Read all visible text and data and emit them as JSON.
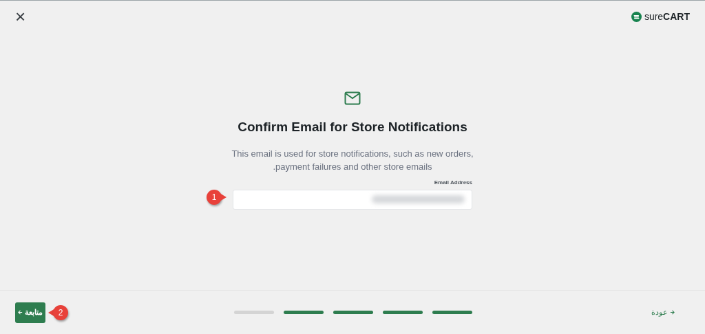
{
  "header": {
    "close_label": "×",
    "logo": {
      "light": "sure",
      "bold": "CART"
    }
  },
  "main": {
    "title": "Confirm Email for Store Notifications",
    "description": "This email is used for store notifications, such as new orders, .payment failures and other store emails",
    "email_field": {
      "label": "Email Address",
      "redacted": true
    }
  },
  "callouts": [
    {
      "number": "1"
    },
    {
      "number": "2"
    }
  ],
  "footer": {
    "continue_button": "متابعة",
    "back_link": "عودة",
    "steps": [
      {
        "done": false
      },
      {
        "done": true
      },
      {
        "done": true
      },
      {
        "done": true
      },
      {
        "done": true
      }
    ]
  }
}
